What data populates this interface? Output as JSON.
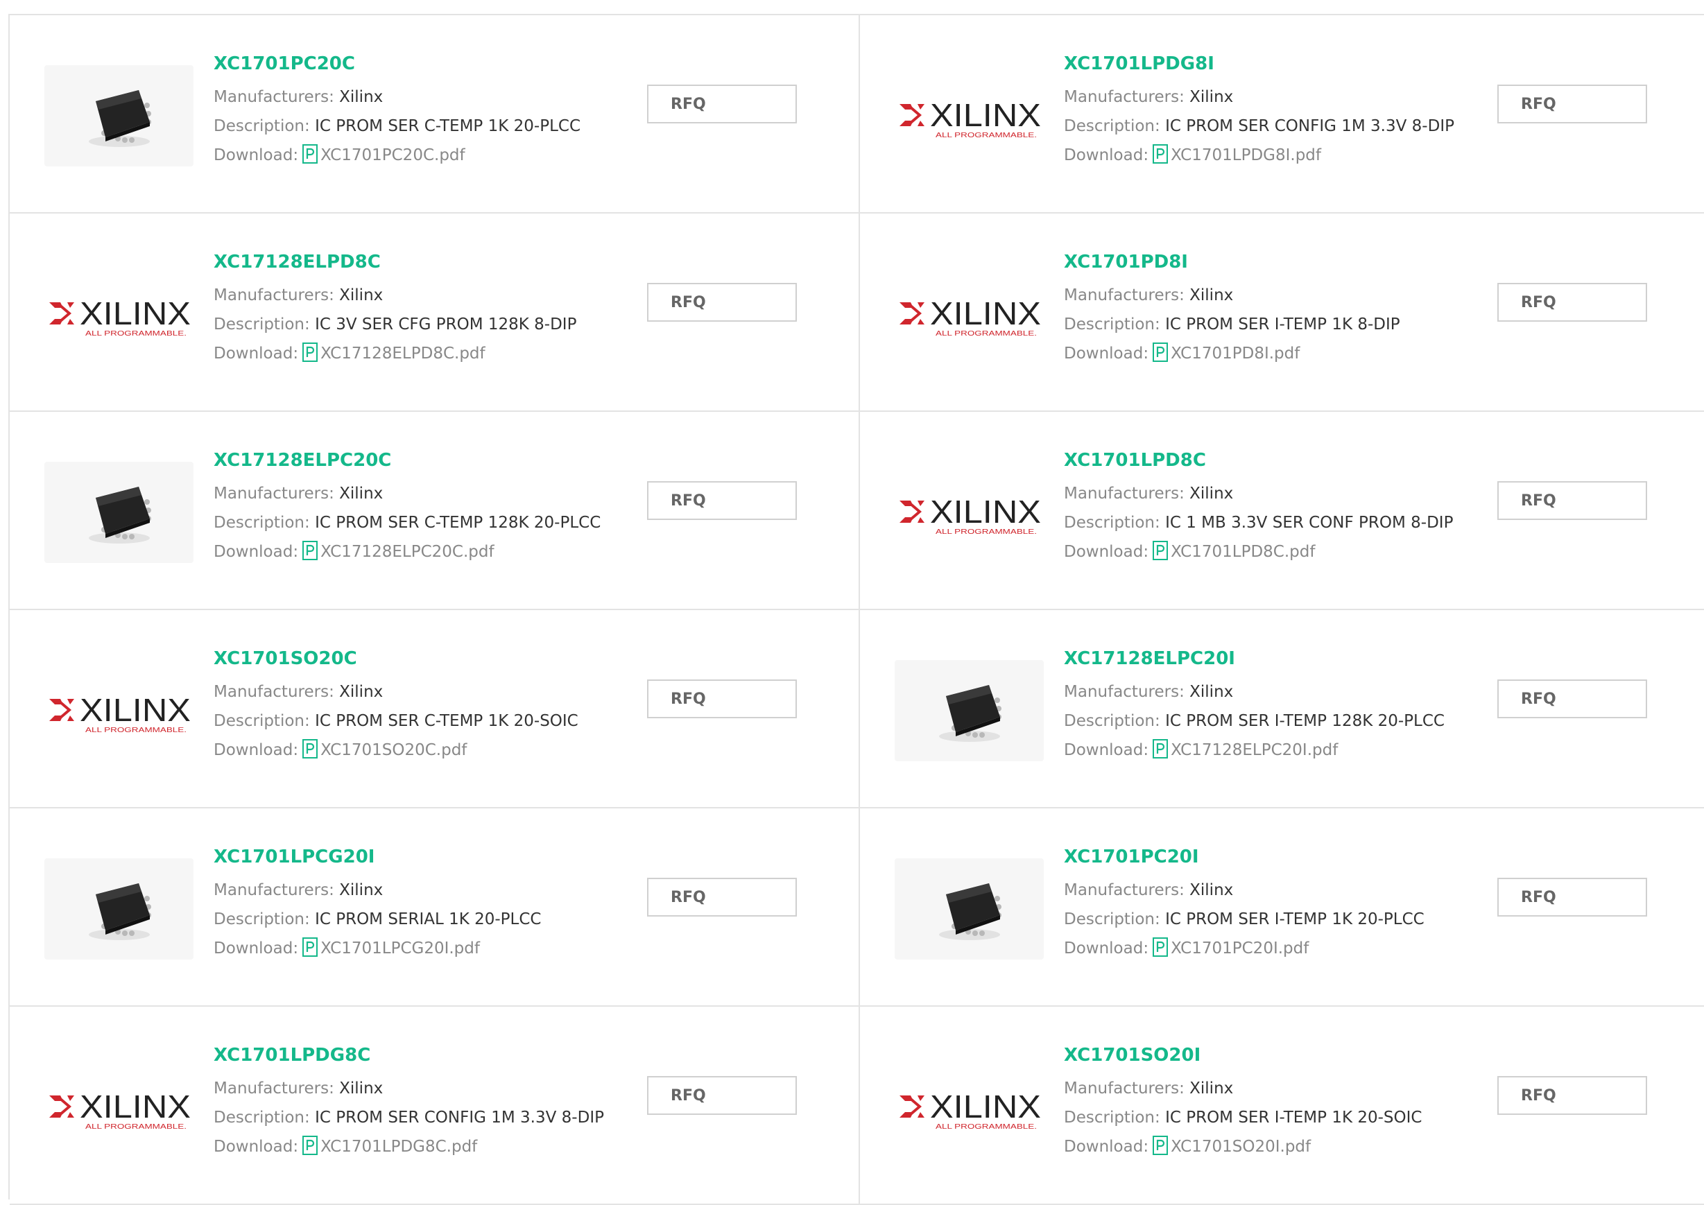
{
  "labels": {
    "manufacturers": "Manufacturers:",
    "description": "Description:",
    "download": "Download:",
    "rfq": "RFQ",
    "logo_text": "XILINX",
    "logo_tagline": "ALL PROGRAMMABLE."
  },
  "colors": {
    "part_link": "#14b88a",
    "logo_red": "#d0262d",
    "border": "#e3e3e3"
  },
  "products": [
    {
      "part": "XC1701PC20C",
      "image": "chip-photo",
      "manufacturer": "Xilinx",
      "description": "IC PROM SER C-TEMP 1K 20-PLCC",
      "file": "XC1701PC20C.pdf"
    },
    {
      "part": "XC1701LPDG8I",
      "image": "xilinx-logo",
      "manufacturer": "Xilinx",
      "description": "IC PROM SER CONFIG 1M 3.3V 8-DIP",
      "file": "XC1701LPDG8I.pdf"
    },
    {
      "part": "XC17128ELPD8C",
      "image": "xilinx-logo",
      "manufacturer": "Xilinx",
      "description": "IC 3V SER CFG PROM 128K 8-DIP",
      "file": "XC17128ELPD8C.pdf"
    },
    {
      "part": "XC1701PD8I",
      "image": "xilinx-logo",
      "manufacturer": "Xilinx",
      "description": "IC PROM SER I-TEMP 1K 8-DIP",
      "file": "XC1701PD8I.pdf"
    },
    {
      "part": "XC17128ELPC20C",
      "image": "chip-photo",
      "manufacturer": "Xilinx",
      "description": "IC PROM SER C-TEMP 128K 20-PLCC",
      "file": "XC17128ELPC20C.pdf"
    },
    {
      "part": "XC1701LPD8C",
      "image": "xilinx-logo",
      "manufacturer": "Xilinx",
      "description": "IC 1 MB 3.3V SER CONF PROM 8-DIP",
      "file": "XC1701LPD8C.pdf"
    },
    {
      "part": "XC1701SO20C",
      "image": "xilinx-logo",
      "manufacturer": "Xilinx",
      "description": "IC PROM SER C-TEMP 1K 20-SOIC",
      "file": "XC1701SO20C.pdf"
    },
    {
      "part": "XC17128ELPC20I",
      "image": "chip-photo",
      "manufacturer": "Xilinx",
      "description": "IC PROM SER I-TEMP 128K 20-PLCC",
      "file": "XC17128ELPC20I.pdf"
    },
    {
      "part": "XC1701LPCG20I",
      "image": "chip-photo",
      "manufacturer": "Xilinx",
      "description": "IC PROM SERIAL 1K 20-PLCC",
      "file": "XC1701LPCG20I.pdf"
    },
    {
      "part": "XC1701PC20I",
      "image": "chip-photo",
      "manufacturer": "Xilinx",
      "description": "IC PROM SER I-TEMP 1K 20-PLCC",
      "file": "XC1701PC20I.pdf"
    },
    {
      "part": "XC1701LPDG8C",
      "image": "xilinx-logo",
      "manufacturer": "Xilinx",
      "description": "IC PROM SER CONFIG 1M 3.3V 8-DIP",
      "file": "XC1701LPDG8C.pdf"
    },
    {
      "part": "XC1701SO20I",
      "image": "xilinx-logo",
      "manufacturer": "Xilinx",
      "description": "IC PROM SER I-TEMP 1K 20-SOIC",
      "file": "XC1701SO20I.pdf"
    }
  ]
}
